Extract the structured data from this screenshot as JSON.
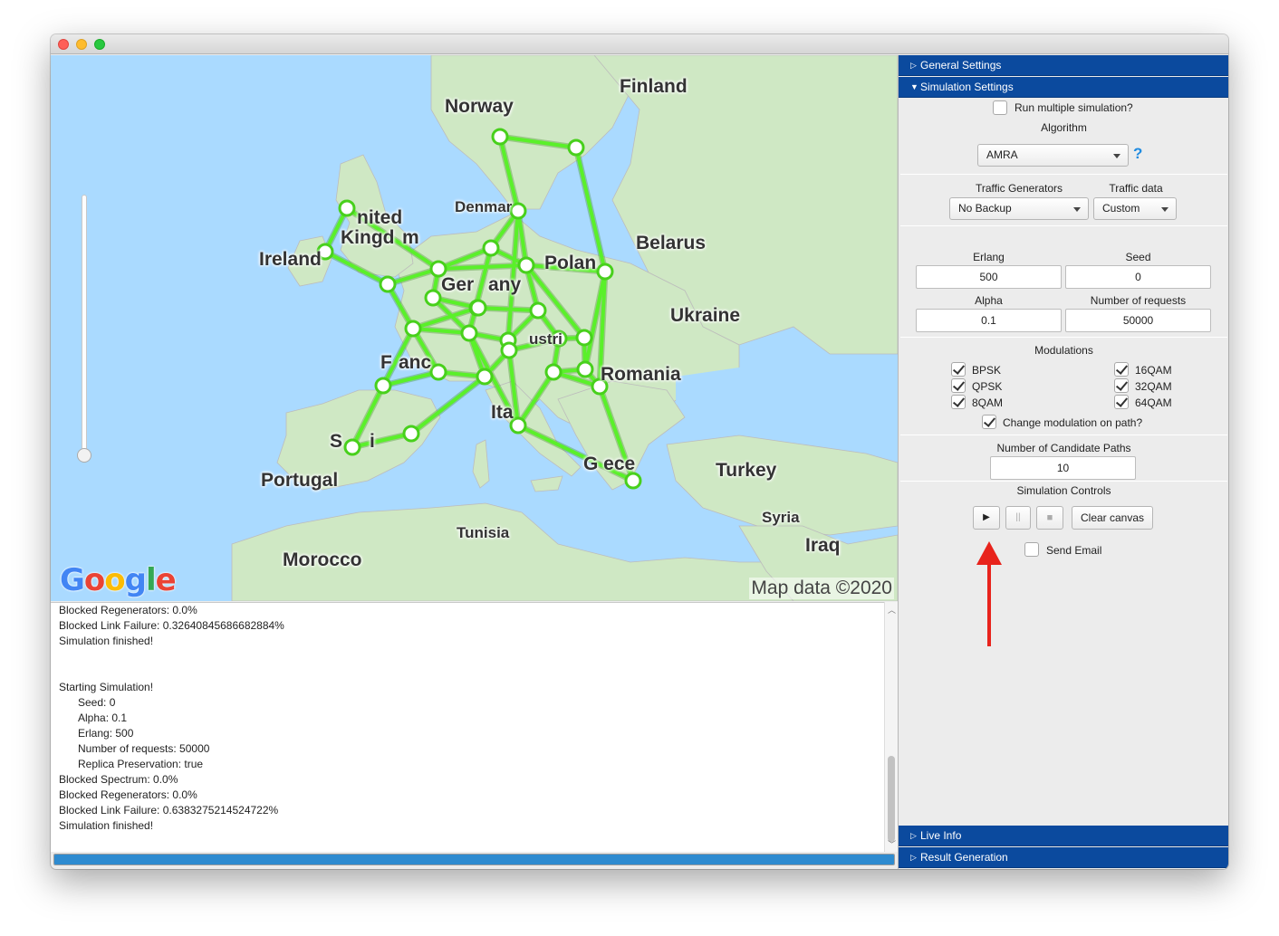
{
  "map": {
    "labels": {
      "finland": "Finland",
      "norway": "Norway",
      "denmark": "Denmar",
      "united": "nited",
      "kingdom": "Kingd",
      "kingdom_m": "m",
      "ireland": "Ireland",
      "belarus": "Belarus",
      "poland": "Polan",
      "germany_a": "Ger",
      "germany_b": "any",
      "ukraine": "Ukraine",
      "france_a": "F",
      "france_b": "anc",
      "austria": "ustri",
      "romania": "Romania",
      "italy": "Ita",
      "spain_a": "S",
      "spain_b": "i",
      "portugal": "Portugal",
      "greece": "G  ece",
      "turkey": "Turkey",
      "syria": "Syria",
      "iraq": "Iraq",
      "tunisia": "Tunisia",
      "morocco": "Morocco"
    },
    "google": [
      "G",
      "o",
      "o",
      "g",
      "l",
      "e"
    ],
    "map_data": "Map data ©2020",
    "link_color": "#5af02a"
  },
  "console": {
    "lines": [
      {
        "text": "Blocked Regenerators: 0.0%",
        "indent": false
      },
      {
        "text": "Blocked Link Failure: 0.32640845686682884%",
        "indent": false
      },
      {
        "text": "Simulation finished!",
        "indent": false
      },
      {
        "text": "",
        "indent": false
      },
      {
        "text": "",
        "indent": false
      },
      {
        "text": "Starting Simulation!",
        "indent": false
      },
      {
        "text": "Seed: 0",
        "indent": true
      },
      {
        "text": "Alpha: 0.1",
        "indent": true
      },
      {
        "text": "Erlang: 500",
        "indent": true
      },
      {
        "text": "Number of requests: 50000",
        "indent": true
      },
      {
        "text": "Replica Preservation: true",
        "indent": true
      },
      {
        "text": "Blocked Spectrum: 0.0%",
        "indent": false
      },
      {
        "text": "Blocked Regenerators: 0.0%",
        "indent": false
      },
      {
        "text": "Blocked Link Failure: 0.6383275214524722%",
        "indent": false
      },
      {
        "text": "Simulation finished!",
        "indent": false
      }
    ],
    "progress": 1.0
  },
  "panel": {
    "general_settings": "General Settings",
    "simulation_settings": "Simulation Settings",
    "run_multiple": "Run multiple simulation?",
    "algorithm_label": "Algorithm",
    "algorithm_value": "AMRA",
    "help": "?",
    "traffic_generators_label": "Traffic Generators",
    "traffic_generators_value": "No Backup",
    "traffic_data_label": "Traffic data",
    "traffic_data_value": "Custom",
    "erlang_label": "Erlang",
    "erlang_value": "500",
    "seed_label": "Seed",
    "seed_value": "0",
    "alpha_label": "Alpha",
    "alpha_value": "0.1",
    "requests_label": "Number of requests",
    "requests_value": "50000",
    "modulations_label": "Modulations",
    "mods": {
      "bpsk": "BPSK",
      "qpsk": "QPSK",
      "qam8": "8QAM",
      "qam16": "16QAM",
      "qam32": "32QAM",
      "qam64": "64QAM"
    },
    "change_mod": "Change modulation on path?",
    "candidate_paths_label": "Number of Candidate Paths",
    "candidate_paths_value": "10",
    "sim_controls_label": "Simulation Controls",
    "play": "▶",
    "pause": "||",
    "stop": "■",
    "clear_canvas": "Clear canvas",
    "send_email": "Send Email",
    "live_info": "Live Info",
    "result_generation": "Result Generation"
  },
  "colors": {
    "accordion": "#0b4a9e",
    "annotation_arrow": "#e8231c"
  }
}
